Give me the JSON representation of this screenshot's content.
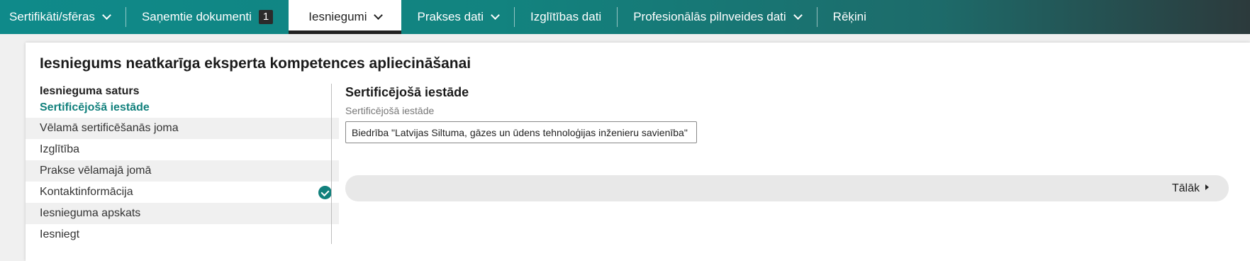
{
  "nav": {
    "items": [
      {
        "label": "Sertifikāti/sfēras",
        "has_chevron": true
      },
      {
        "label": "Saņemtie dokumenti",
        "badge": "1"
      },
      {
        "label": "Iesniegumi",
        "has_chevron": true,
        "active": true
      },
      {
        "label": "Prakses dati",
        "has_chevron": true
      },
      {
        "label": "Izglītības dati"
      },
      {
        "label": "Profesionālās pilnveides dati",
        "has_chevron": true
      },
      {
        "label": "Rēķini"
      }
    ]
  },
  "page": {
    "title": "Iesniegums neatkarīga eksperta kompetences apliecināšanai"
  },
  "steps": {
    "heading": "Iesnieguma saturs",
    "active_label": "Sertificējošā iestāde",
    "items": [
      {
        "label": "Vēlamā sertificēšanās joma"
      },
      {
        "label": "Izglītība"
      },
      {
        "label": "Prakse vēlamajā jomā"
      },
      {
        "label": "Kontaktinformācija",
        "completed": true
      },
      {
        "label": "Iesnieguma apskats"
      },
      {
        "label": "Iesniegt"
      }
    ]
  },
  "form": {
    "section_title": "Sertificējošā iestāde",
    "field_label": "Sertificējošā iestāde",
    "field_value": "Biedrība \"Latvijas Siltuma, gāzes un ūdens tehnoloģijas inženieru savienība\""
  },
  "footer": {
    "next_label": "Tālāk"
  },
  "colors": {
    "accent": "#11807c",
    "nav_start": "#0f8a8a",
    "nav_end": "#2c3a3c"
  }
}
